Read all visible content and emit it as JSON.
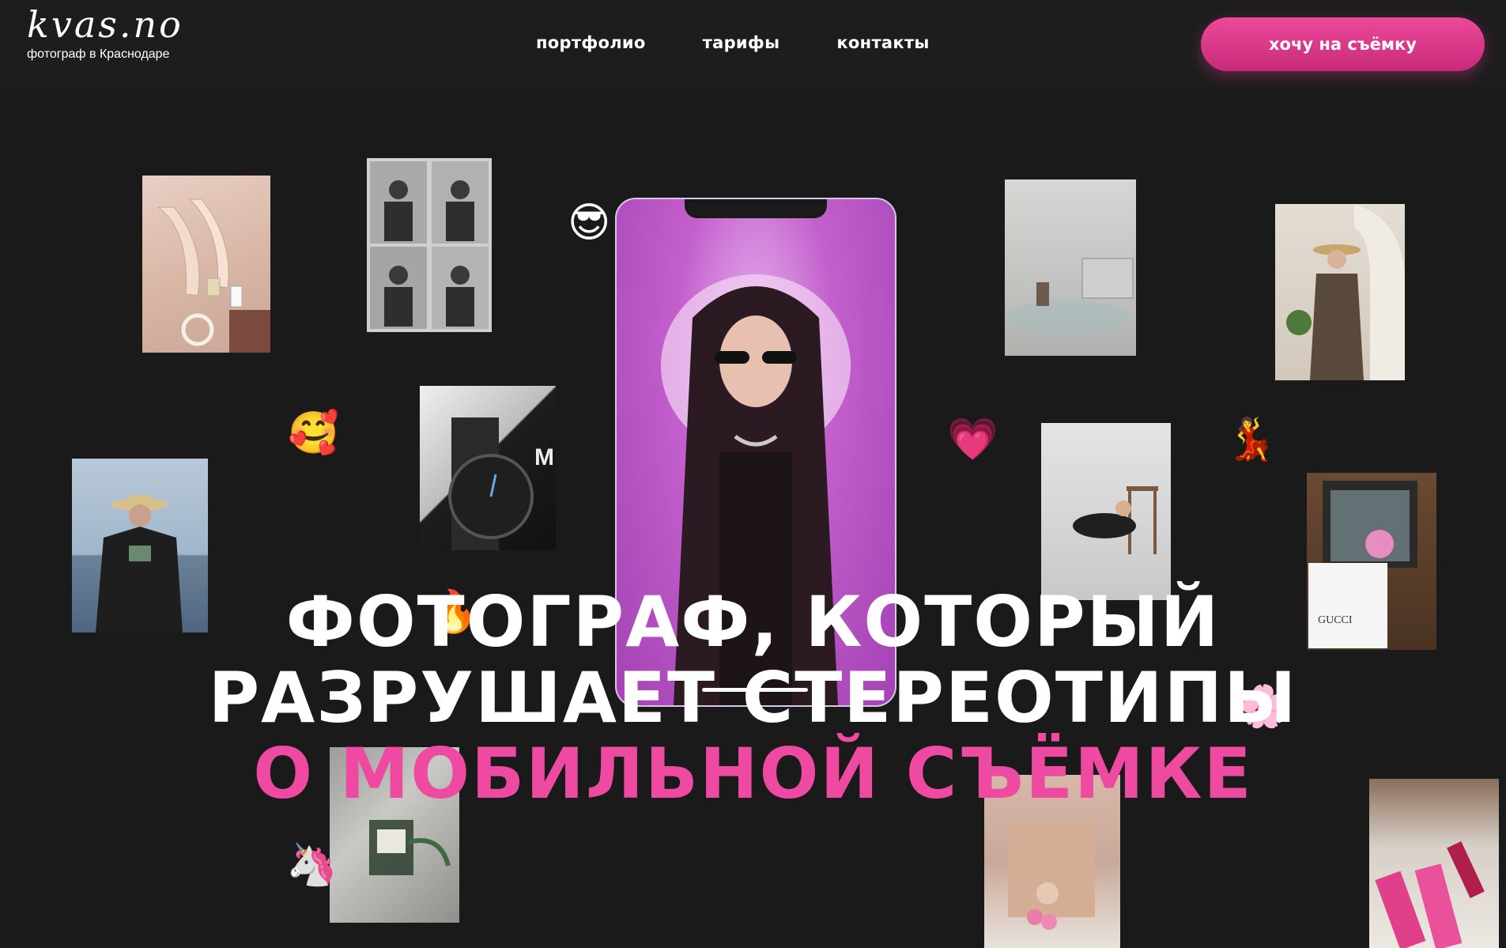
{
  "brand": {
    "logo_text": "kvas.no",
    "tagline": "фотограф в Краснодаре"
  },
  "nav": {
    "items": [
      {
        "label": "портфолио"
      },
      {
        "label": "тарифы"
      },
      {
        "label": "контакты"
      }
    ]
  },
  "cta": {
    "label": "хочу на съёмку"
  },
  "hero": {
    "line1": "ФОТОГРАФ, КОТОРЫЙ",
    "line2": "РАЗРУШАЕТ СТЕРЕОТИПЫ",
    "line3": "О МОБИЛЬНОЙ СЪЁМКЕ"
  },
  "emojis": {
    "sunglasses": "😎",
    "smiling_hearts": "🥰",
    "fire": "🔥",
    "unicorn": "🦄",
    "sparkling_heart": "💗",
    "dancer": "💃",
    "blossom": "🌸"
  },
  "colors": {
    "background": "#1a1a1b",
    "accent_pink": "#ee4aa2",
    "button_gradient_top": "#ec4a99",
    "button_gradient_bottom": "#c82a7a",
    "phone_purple": "#b44fc0"
  }
}
